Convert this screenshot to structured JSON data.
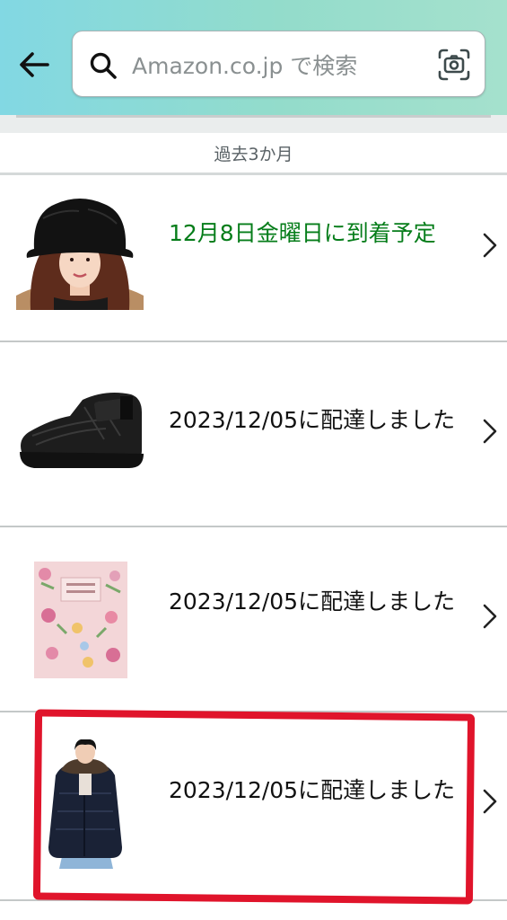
{
  "search": {
    "placeholder": "Amazon.co.jp で検索"
  },
  "section": {
    "label": "過去3か月"
  },
  "orders": [
    {
      "status": "12月8日金曜日に到着予定",
      "status_color": "#067d1a",
      "product_icon": "fur-bucket-hat-photo"
    },
    {
      "status": "2023/12/05に配達しました",
      "product_icon": "black-quilted-boot-photo"
    },
    {
      "status": "2023/12/05に配達しました",
      "product_icon": "floral-letter-paper-photo"
    },
    {
      "status": "2023/12/05に配達しました",
      "product_icon": "navy-down-jacket-photo"
    }
  ],
  "colors": {
    "header_gradient_start": "#82d8e3",
    "header_gradient_end": "#a5e1cd",
    "delivery_expected": "#067d1a",
    "highlight_annotation": "#e0142b"
  }
}
